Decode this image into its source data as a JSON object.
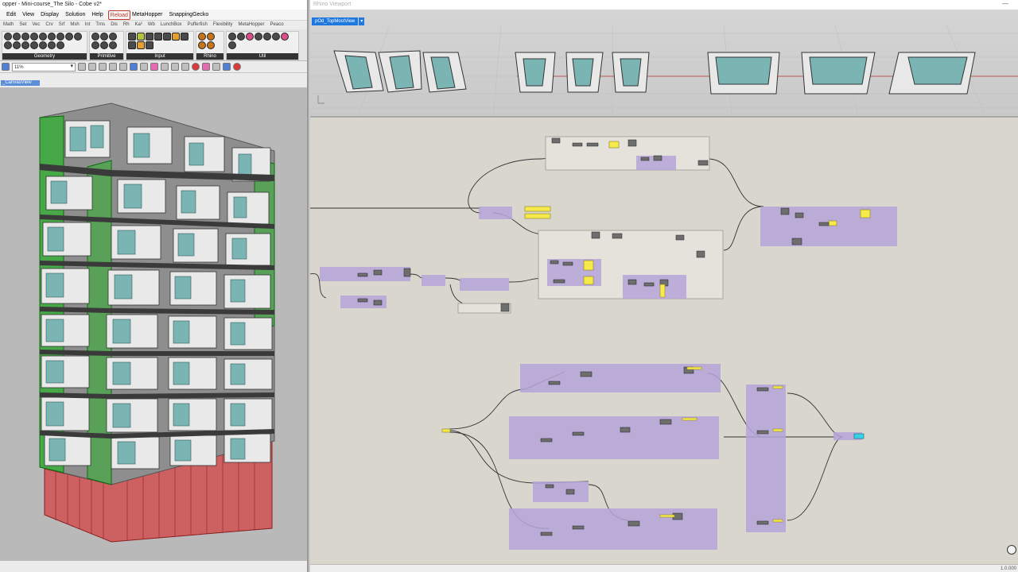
{
  "window": {
    "title": "opper - Mini-course_The Silo - Cobe v2*"
  },
  "menu": {
    "items": [
      "Edit",
      "View",
      "Display",
      "Solution",
      "Help"
    ],
    "reload": "Reload",
    "plugins": [
      "MetaHopper",
      "SnappingGecko"
    ]
  },
  "component_tabs": [
    "Math",
    "Set",
    "Vec",
    "Crv",
    "Srf",
    "Msh",
    "Int",
    "Trns",
    "Dis",
    "Rh",
    "Ka²",
    "Wb",
    "LunchBox",
    "Pufferfish",
    "Flexibility",
    "MetaHopper",
    "Peaco"
  ],
  "ribbon_groups": [
    "Geometry",
    "Primitive",
    "Input",
    "Rhino",
    "Util"
  ],
  "toolbar": {
    "zoom_value": "11%"
  },
  "canvas_tab": {
    "label": "_CanvasView"
  },
  "rhino_viewport": {
    "window_title": "Rhino Viewport",
    "viewport_name": "pOd_TopMostView"
  },
  "status_bar": {
    "version": "1.0.000"
  },
  "colors": {
    "accent_blue": "#1f78e0",
    "group_purple": "#b5a3d8",
    "group_grey": "#e2e0d8",
    "panel_yellow": "#f5e94c",
    "glass_teal": "#7ab5b4",
    "facade_green": "#2db02d",
    "base_red": "#d63a3a"
  }
}
